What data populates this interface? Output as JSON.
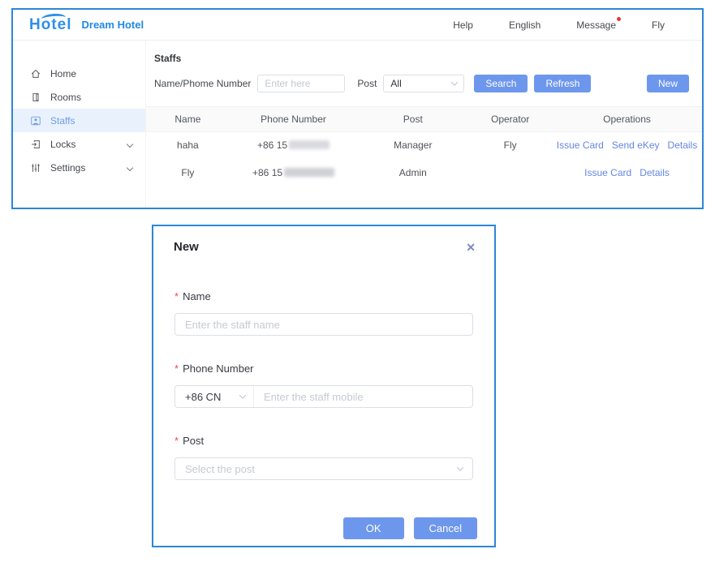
{
  "colors": {
    "accent_blue": "#6d97ed",
    "border_blue": "#2c87d6",
    "link_blue": "#6486e4",
    "brand_blue": "#1e88e5",
    "badge_red": "#e23b30"
  },
  "window": {
    "logo_text": "Hotel",
    "brand": "Dream Hotel",
    "topnav": [
      {
        "label": "Help"
      },
      {
        "label": "English"
      },
      {
        "label": "Message"
      },
      {
        "label": "Fly"
      }
    ],
    "sidebar": [
      {
        "label": "Home"
      },
      {
        "label": "Rooms"
      },
      {
        "label": "Staffs"
      },
      {
        "label": "Locks"
      },
      {
        "label": "Settings"
      }
    ],
    "content": {
      "title": "Staffs",
      "filter": {
        "name_label": "Name/Phome Number",
        "name_placeholder": "Enter here",
        "post_label": "Post",
        "post_value": "All",
        "search_label": "Search",
        "refresh_label": "Refresh",
        "new_label": "New"
      },
      "table": {
        "headers": [
          "Name",
          "Phone Number",
          "Post",
          "Operator",
          "Operations"
        ],
        "rows": [
          {
            "name": "haha",
            "phone_prefix": "+86 15",
            "post": "Manager",
            "operator": "Fly",
            "operations": [
              "Issue Card",
              "Send eKey",
              "Details"
            ]
          },
          {
            "name": "Fly",
            "phone_prefix": "+86 15",
            "post": "Admin",
            "operator": "",
            "operations": [
              "Issue Card",
              "Details"
            ]
          }
        ]
      }
    }
  },
  "modal": {
    "title": "New",
    "close_label": "✕",
    "required_marker": "*",
    "name_label": "Name",
    "name_placeholder": "Enter the staff name",
    "phone_label": "Phone Number",
    "phone_prefix": "+86 CN",
    "phone_placeholder": "Enter the staff mobile",
    "post_label": "Post",
    "post_placeholder": "Select the post",
    "ok_label": "OK",
    "cancel_label": "Cancel"
  }
}
